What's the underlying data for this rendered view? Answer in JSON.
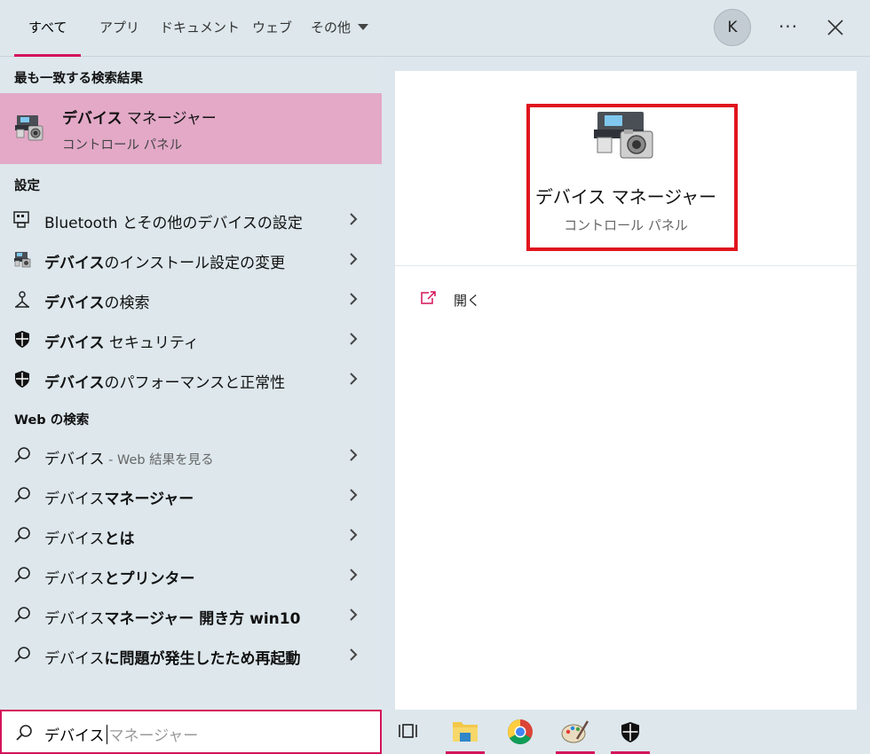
{
  "tabs": [
    {
      "label": "すべて",
      "active": true
    },
    {
      "label": "アプリ"
    },
    {
      "label": "ドキュメント"
    },
    {
      "label": "ウェブ"
    },
    {
      "label": "その他"
    }
  ],
  "header": {
    "avatar_initial": "K",
    "more_label": "···"
  },
  "left": {
    "best_match_heading": "最も一致する検索結果",
    "best_match": {
      "title_bold": "デバイス",
      "title_rest": " マネージャー",
      "subtitle": "コントロール パネル",
      "icon": "device-manager-icon"
    },
    "settings_heading": "設定",
    "settings": [
      {
        "pre": "",
        "bold": "",
        "post": "Bluetooth とその他のデバイスの設定",
        "icon": "bluetooth-devices-icon"
      },
      {
        "pre": "",
        "bold": "デバイス",
        "post": "のインストール設定の変更",
        "icon": "device-install-icon"
      },
      {
        "pre": "",
        "bold": "デバイス",
        "post": "の検索",
        "icon": "find-device-icon"
      },
      {
        "pre": "",
        "bold": "デバイス",
        "post": " セキュリティ",
        "icon": "shield-icon"
      },
      {
        "pre": "",
        "bold": "デバイス",
        "post": "のパフォーマンスと正常性",
        "icon": "shield-icon"
      }
    ],
    "web_heading": "Web の検索",
    "web": [
      {
        "pre": "デバイス",
        "bold": "",
        "muted": " - Web 結果を見る"
      },
      {
        "pre": "デバイス",
        "bold": "マネージャー",
        "muted": ""
      },
      {
        "pre": "デバイス",
        "bold": "とは",
        "muted": ""
      },
      {
        "pre": "デバイス",
        "bold": "とプリンター",
        "muted": ""
      },
      {
        "pre": "デバイス",
        "bold": "マネージャー 開き方 win10",
        "muted": ""
      },
      {
        "pre": "デバイス",
        "bold": "に問題が発生したため再起動",
        "muted": ""
      }
    ]
  },
  "preview": {
    "title": "デバイス マネージャー",
    "subtitle": "コントロール パネル",
    "open_label": "開く",
    "highlight_color": "#e0141e"
  },
  "search": {
    "typed": "デバイス",
    "suggestion": "マネージャー"
  },
  "taskbar": {
    "items": [
      "task-view-icon",
      "file-explorer-icon",
      "chrome-icon",
      "paint-icon",
      "windows-security-icon"
    ]
  },
  "colors": {
    "accent": "#d4145a",
    "selection": "#e3a9c7",
    "pane_bg": "#dde7ec"
  }
}
